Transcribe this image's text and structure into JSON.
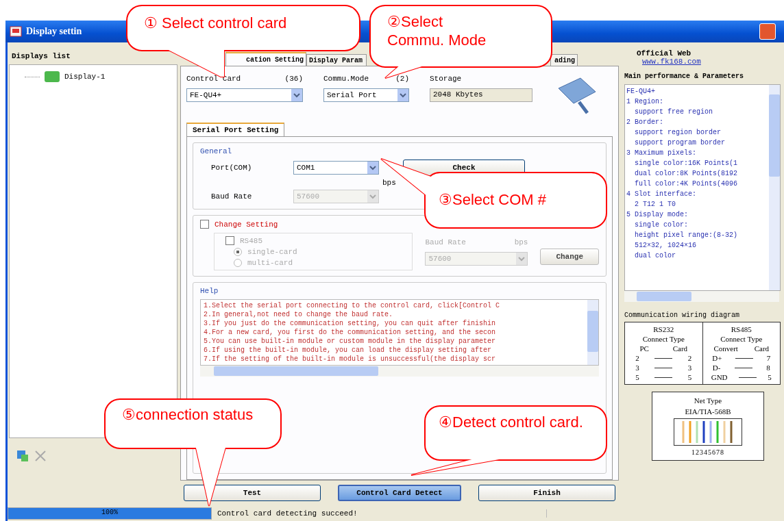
{
  "window": {
    "title": "Display settin"
  },
  "displays_list": {
    "header": "Displays list",
    "items": [
      {
        "label": "Display-1"
      }
    ]
  },
  "tabs": [
    {
      "label": "cation Setting",
      "selected": true
    },
    {
      "label": "Display Param",
      "selected": false
    },
    {
      "label": "ading",
      "selected": false
    }
  ],
  "control_card": {
    "label": "Control Card",
    "count": "(36)",
    "value": "FE-QU4+"
  },
  "comm_mode": {
    "label": "Commu.Mode",
    "count": "(2)",
    "value": "Serial Port"
  },
  "storage": {
    "label": "Storage",
    "value": "2048 Kbytes"
  },
  "subtab": {
    "label": "Serial Port Setting",
    "selected": true
  },
  "general": {
    "title": "General",
    "port_label": "Port(COM)",
    "port_value": "COM1",
    "check_button": "Check",
    "bps": "bps",
    "baud_label": "Baud Rate",
    "baud_value": "57600",
    "baud_disabled": true
  },
  "change_setting": {
    "label": "Change Setting",
    "checked": false,
    "disabled": true,
    "rs485": {
      "label": "RS485",
      "checked": false
    },
    "modes": [
      {
        "label": "single-card",
        "selected": true
      },
      {
        "label": "multi-card",
        "selected": false
      }
    ],
    "baud_label": "Baud Rate",
    "bps": "bps",
    "baud_value": "57600",
    "button": "Change"
  },
  "help": {
    "title": "Help",
    "lines": [
      "1.Select the serial port connecting to the control card, click[Control C",
      "2.In general,not need to change the baud rate.",
      "3.If you just do the communication setting, you can quit after finishin",
      "4.For a new card, you first do the communication setting, and the secon",
      "5.You can use built-in module or custom module in the display parameter",
      "6.If using the built-in module, you can load the display setting after",
      "7.If the setting of the built-in module is unsuccessful(the display scr"
    ]
  },
  "buttons": [
    {
      "label": "Test",
      "kind": "normal"
    },
    {
      "label": "Control Card Detect",
      "kind": "default"
    },
    {
      "label": "Finish",
      "kind": "normal"
    }
  ],
  "info": {
    "official_label": "Official Web",
    "link": "www.fk168.com",
    "params_title": "Main performance & Parameters",
    "params": [
      "FE-QU4+",
      "1 Region:",
      "  support free region",
      "2 Border:",
      "  support region border",
      "  support program border",
      "3 Maximum pixels:",
      "  single color:16K Points(1",
      "  dual color:8K Points(8192",
      "  full color:4K Points(4096",
      "4 Slot interface:",
      "  2 T12 1 T0",
      "5 Display mode:",
      "  single color:",
      "  height pixel range:(8-32)",
      "  512×32, 1024×16",
      "  dual color"
    ],
    "wiring_title": "Communication wiring diagram",
    "rs232": {
      "title": "RS232",
      "subtitle": "Connect Type",
      "col_a": "PC",
      "col_b": "Card",
      "rows": [
        [
          "2",
          "2"
        ],
        [
          "3",
          "3"
        ],
        [
          "5",
          "5"
        ]
      ]
    },
    "rs485": {
      "title": "RS485",
      "subtitle": "Connect Type",
      "col_a": "Convert",
      "col_b": "Card",
      "rows": [
        [
          "D+",
          "7"
        ],
        [
          "D-",
          "8"
        ],
        [
          "GND",
          "5"
        ]
      ]
    },
    "net": {
      "title": "Net Type",
      "standard": "EIA/TIA-568B",
      "pins": "12345678"
    }
  },
  "status_bar": {
    "level": 1,
    "progress_text": "100%",
    "message": "Control card detecting succeed!"
  },
  "callouts": [
    {
      "text": "① Select control card"
    },
    {
      "text": "②Select Commu. Mode"
    },
    {
      "text": "③Select COM #"
    },
    {
      "text": "④Detect control card."
    },
    {
      "text": "⑤connection status"
    }
  ]
}
